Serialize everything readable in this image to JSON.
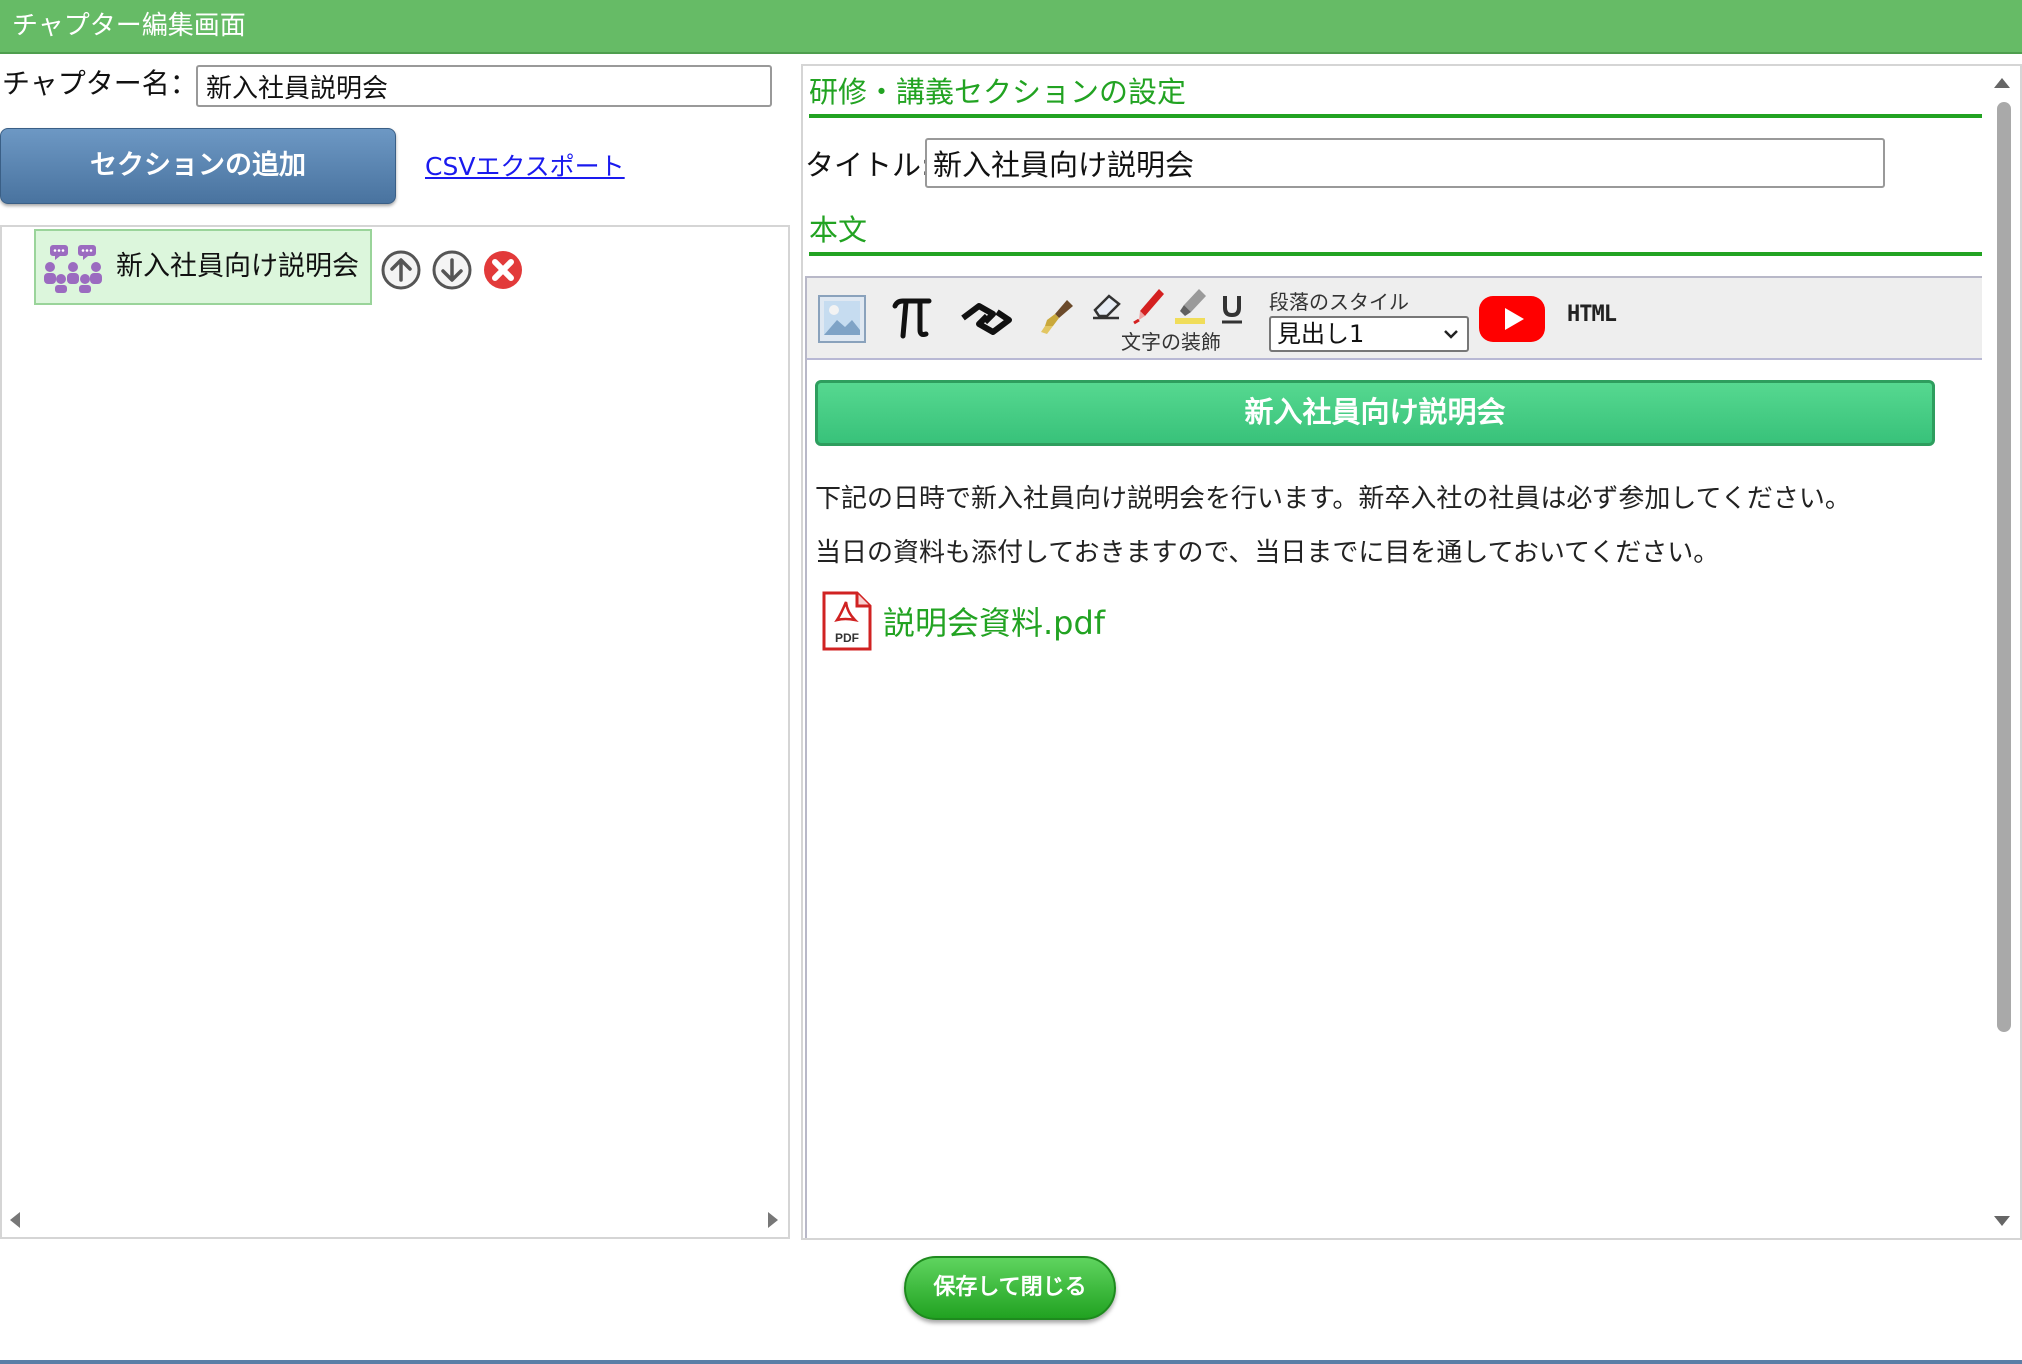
{
  "window": {
    "title": "チャプター編集画面"
  },
  "chapter": {
    "name_label": "チャプター名：",
    "name_value": "新入社員説明会"
  },
  "left": {
    "add_section_label": "セクションの追加",
    "csv_export_label": "CSVエクスポート",
    "sections": [
      {
        "label": "新入社員向け説明会",
        "icon": "people-meeting-icon"
      }
    ]
  },
  "right": {
    "section_settings_heading": "研修・講義セクションの設定",
    "title_label": "タイトル:",
    "title_value": "新入社員向け説明会",
    "body_heading": "本文",
    "toolbar": {
      "text_decoration_caption": "文字の装飾",
      "paragraph_style_caption": "段落のスタイル",
      "paragraph_style_value": "見出し1",
      "html_label": "HTML",
      "icons": [
        "image-icon",
        "pi-formula-icon",
        "link-icon",
        "brush-icon",
        "eraser-icon",
        "red-marker-icon",
        "highlighter-icon",
        "underline-icon",
        "youtube-icon"
      ]
    },
    "content": {
      "heading": "新入社員向け説明会",
      "paragraphs": [
        "下記の日時で新入社員向け説明会を行います。新卒入社の社員は必ず参加してください。",
        "当日の資料も添付しておきますので、当日までに目を通しておいてください。"
      ],
      "attachment": {
        "name": "説明会資料.pdf",
        "icon": "pdf-icon"
      }
    }
  },
  "footer": {
    "save_close_label": "保存して閉じる"
  },
  "colors": {
    "titlebar": "#66bb66",
    "accent_green": "#22a322",
    "add_button": "#5a86b3",
    "heading_bar": "#3cc680",
    "link_blue": "#1a1aee"
  }
}
